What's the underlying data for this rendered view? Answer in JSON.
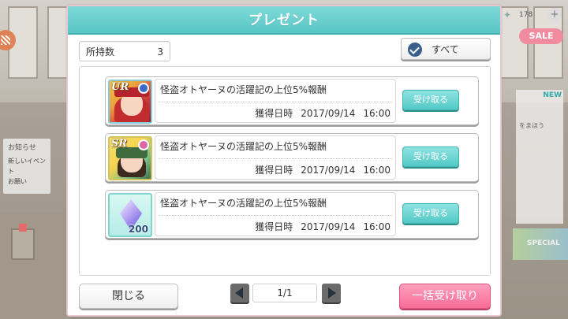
{
  "dialog": {
    "title": "プレゼント"
  },
  "summary": {
    "count_label": "所持数",
    "count_value": "3"
  },
  "filter": {
    "label": "すべて"
  },
  "items": [
    {
      "rarity": "UR",
      "title": "怪盗オトヤーヌの活躍記の上位5%報酬",
      "acquired_label": "獲得日時",
      "date": "2017/09/14",
      "time": "16:00",
      "button": "受け取る"
    },
    {
      "rarity": "SR",
      "title": "怪盗オトヤーヌの活躍記の上位5%報酬",
      "acquired_label": "獲得日時",
      "date": "2017/09/14",
      "time": "16:00",
      "button": "受け取る"
    },
    {
      "quantity": "200",
      "title": "怪盗オトヤーヌの活躍記の上位5%報酬",
      "acquired_label": "獲得日時",
      "date": "2017/09/14",
      "time": "16:00",
      "button": "受け取る"
    }
  ],
  "pager": {
    "current": "1/1"
  },
  "footer": {
    "close_label": "閉じる",
    "receive_all_label": "一括受け取り"
  },
  "background": {
    "counter": "178",
    "sale": "SALE",
    "panel_tag": "お知らせ",
    "panel_text_1": "新しいイベント",
    "panel_text_2": "お願い",
    "new_badge": "NEW",
    "right_text": "をまほう",
    "banner_text": "SPECIAL"
  },
  "colors": {
    "header": "#58c6c5",
    "receive": "#53c9c6",
    "receive_all": "#f56c97",
    "check": "#3b5f8d"
  }
}
